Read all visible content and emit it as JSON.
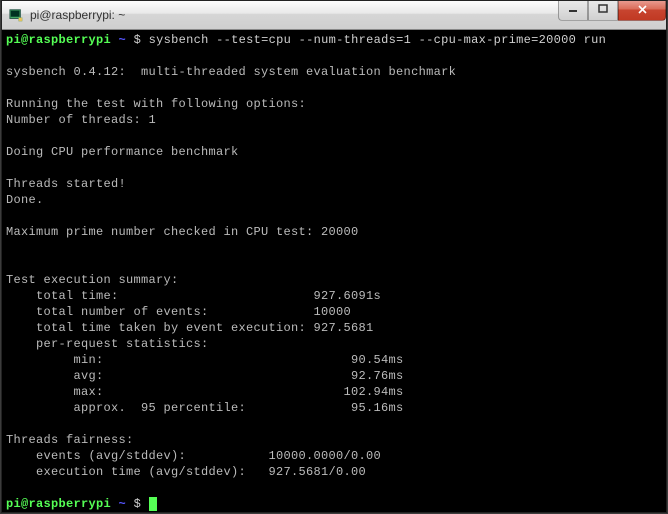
{
  "window": {
    "title": "pi@raspberrypi: ~",
    "icon_name": "putty-icon"
  },
  "prompt": {
    "user_host": "pi@raspberrypi",
    "sep1": " ",
    "path": "~",
    "sep2": " $ ",
    "command": "sysbench --test=cpu --num-threads=1 --cpu-max-prime=20000 run"
  },
  "output": {
    "blank": "",
    "version_line": "sysbench 0.4.12:  multi-threaded system evaluation benchmark",
    "running_line": "Running the test with following options:",
    "threads_line": "Number of threads: 1",
    "doing_line": "Doing CPU performance benchmark",
    "threads_started": "Threads started!",
    "done": "Done.",
    "max_prime": "Maximum prime number checked in CPU test: 20000",
    "summary_header": "Test execution summary:",
    "total_time": "    total time:                          927.6091s",
    "total_events": "    total number of events:              10000",
    "total_event_exec": "    total time taken by event execution: 927.5681",
    "per_req_header": "    per-request statistics:",
    "stat_min": "         min:                                 90.54ms",
    "stat_avg": "         avg:                                 92.76ms",
    "stat_max": "         max:                                102.94ms",
    "stat_p95": "         approx.  95 percentile:              95.16ms",
    "fairness_header": "Threads fairness:",
    "fairness_events": "    events (avg/stddev):           10000.0000/0.00",
    "fairness_exec": "    execution time (avg/stddev):   927.5681/0.00"
  },
  "prompt2": {
    "user_host": "pi@raspberrypi",
    "sep1": " ",
    "path": "~",
    "sep2": " $ "
  }
}
